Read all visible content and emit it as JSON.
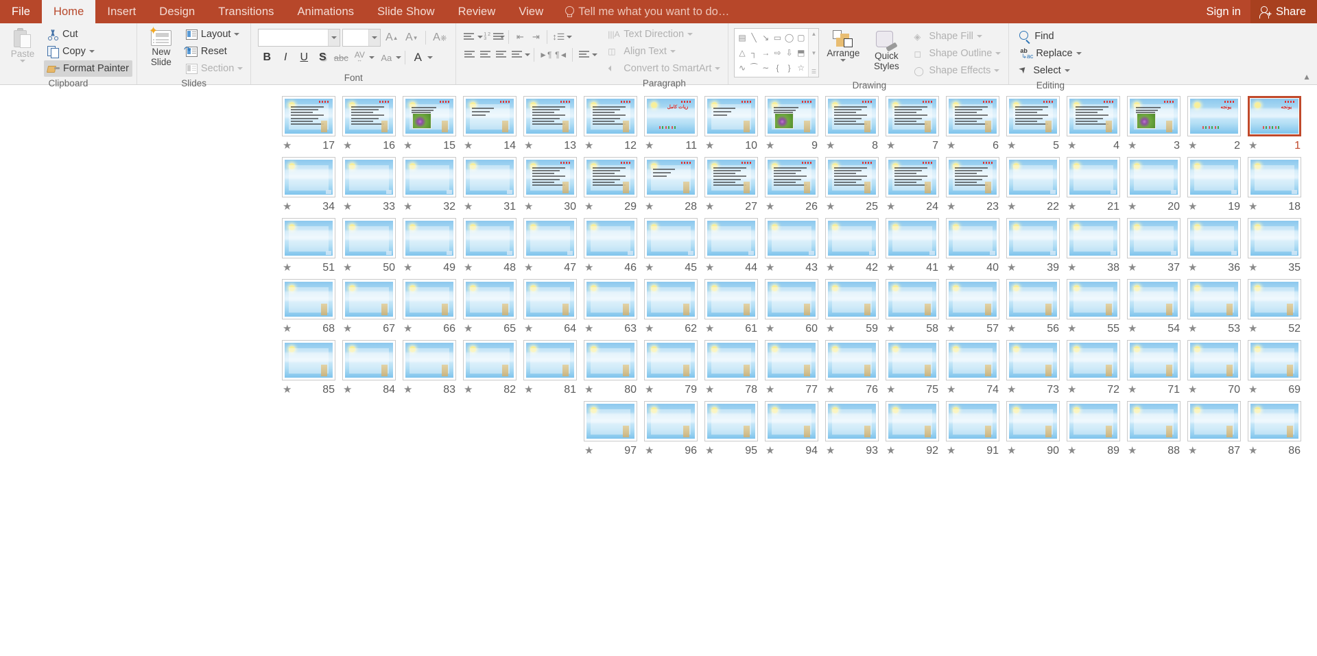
{
  "app": {
    "tabs": [
      {
        "label": "File",
        "type": "file"
      },
      {
        "label": "Home",
        "active": true
      },
      {
        "label": "Insert"
      },
      {
        "label": "Design"
      },
      {
        "label": "Transitions"
      },
      {
        "label": "Animations"
      },
      {
        "label": "Slide Show"
      },
      {
        "label": "Review"
      },
      {
        "label": "View"
      }
    ],
    "tell_me": "Tell me what you want to do…",
    "sign_in": "Sign in",
    "share": "Share",
    "accent_color": "#b7472a",
    "selection_color": "#c0492b"
  },
  "ribbon": {
    "groups": {
      "clipboard": {
        "label": "Clipboard",
        "paste": "Paste",
        "cut": "Cut",
        "copy": "Copy",
        "format_painter": "Format Painter"
      },
      "slides": {
        "label": "Slides",
        "new_slide_line1": "New",
        "new_slide_line2": "Slide",
        "layout": "Layout",
        "reset": "Reset",
        "section": "Section"
      },
      "font": {
        "label": "Font",
        "font_name_value": "",
        "font_size_value": "",
        "grow_font": "A",
        "shrink_font": "A",
        "clear_formatting": "A",
        "bold": "B",
        "italic": "I",
        "underline": "U",
        "shadow": "S",
        "strikethrough": "abc",
        "character_spacing": "AV",
        "change_case": "Aa",
        "font_color": "A"
      },
      "paragraph": {
        "label": "Paragraph",
        "text_direction": "Text Direction",
        "align_text": "Align Text",
        "convert_to_smartart": "Convert to SmartArt",
        "numbering_sample": "1 2 3"
      },
      "drawing": {
        "label": "Drawing",
        "arrange": "Arrange",
        "quick_styles_line1": "Quick",
        "quick_styles_line2": "Styles",
        "shape_fill": "Shape Fill",
        "shape_outline": "Shape Outline",
        "shape_effects": "Shape Effects",
        "shapes": [
          "textbox-shape",
          "line-shape",
          "arrow-shape",
          "rectangle-shape",
          "oval-shape",
          "rounded-rectangle-shape",
          "triangle-shape",
          "elbow-connector-shape",
          "elbow-arrow-shape",
          "right-arrow-shape",
          "down-arrow-shape",
          "folded-corner-shape",
          "scribble-shape",
          "arc-shape",
          "curve-shape",
          "left-brace-shape",
          "right-brace-shape",
          "star-shape"
        ],
        "shape_glyphs": [
          "▤",
          "╲",
          "↘",
          "▭",
          "◯",
          "▢",
          "△",
          "┐",
          "→",
          "⇨",
          "⇩",
          "⬒",
          "∿",
          "⁀",
          "∼",
          "{",
          "}",
          "☆"
        ]
      },
      "editing": {
        "label": "Editing",
        "find": "Find",
        "replace": "Replace",
        "select": "Select"
      }
    }
  },
  "slide_sorter": {
    "selected_slide": 1,
    "total_slides": 97,
    "rows": [
      {
        "from": 17,
        "to": 1
      },
      {
        "from": 34,
        "to": 18
      },
      {
        "from": 51,
        "to": 35
      },
      {
        "from": 68,
        "to": 52
      },
      {
        "from": 85,
        "to": 69
      },
      {
        "from": 97,
        "to": 86
      }
    ],
    "slides": [
      {
        "n": 1,
        "kind": "title",
        "title": "يونجه",
        "selected": true
      },
      {
        "n": 2,
        "kind": "title",
        "title": "يونجه"
      },
      {
        "n": 3,
        "kind": "photo"
      },
      {
        "n": 4,
        "kind": "text"
      },
      {
        "n": 5,
        "kind": "text"
      },
      {
        "n": 6,
        "kind": "text"
      },
      {
        "n": 7,
        "kind": "text"
      },
      {
        "n": 8,
        "kind": "text"
      },
      {
        "n": 9,
        "kind": "photo"
      },
      {
        "n": 10,
        "kind": "sparse"
      },
      {
        "n": 11,
        "kind": "title",
        "title": "زيات کامل"
      },
      {
        "n": 12,
        "kind": "text"
      },
      {
        "n": 13,
        "kind": "text"
      },
      {
        "n": 14,
        "kind": "sparse"
      },
      {
        "n": 15,
        "kind": "photo"
      },
      {
        "n": 16,
        "kind": "text"
      },
      {
        "n": 17,
        "kind": "text"
      },
      {
        "n": 18,
        "kind": "empty"
      },
      {
        "n": 19,
        "kind": "empty"
      },
      {
        "n": 20,
        "kind": "empty"
      },
      {
        "n": 21,
        "kind": "empty"
      },
      {
        "n": 22,
        "kind": "empty"
      },
      {
        "n": 23,
        "kind": "text"
      },
      {
        "n": 24,
        "kind": "text"
      },
      {
        "n": 25,
        "kind": "text"
      },
      {
        "n": 26,
        "kind": "text"
      },
      {
        "n": 27,
        "kind": "text"
      },
      {
        "n": 28,
        "kind": "sparse"
      },
      {
        "n": 29,
        "kind": "text"
      },
      {
        "n": 30,
        "kind": "text"
      },
      {
        "n": 31,
        "kind": "empty"
      },
      {
        "n": 32,
        "kind": "empty"
      },
      {
        "n": 33,
        "kind": "empty"
      },
      {
        "n": 34,
        "kind": "empty"
      },
      {
        "n": 35,
        "kind": "empty"
      },
      {
        "n": 36,
        "kind": "empty"
      },
      {
        "n": 37,
        "kind": "empty"
      },
      {
        "n": 38,
        "kind": "empty"
      },
      {
        "n": 39,
        "kind": "empty"
      },
      {
        "n": 40,
        "kind": "empty"
      },
      {
        "n": 41,
        "kind": "empty"
      },
      {
        "n": 42,
        "kind": "empty"
      },
      {
        "n": 43,
        "kind": "empty"
      },
      {
        "n": 44,
        "kind": "empty"
      },
      {
        "n": 45,
        "kind": "empty"
      },
      {
        "n": 46,
        "kind": "empty"
      },
      {
        "n": 47,
        "kind": "empty"
      },
      {
        "n": 48,
        "kind": "empty"
      },
      {
        "n": 49,
        "kind": "empty"
      },
      {
        "n": 50,
        "kind": "empty"
      },
      {
        "n": 51,
        "kind": "empty"
      },
      {
        "n": 52,
        "kind": "blank"
      },
      {
        "n": 53,
        "kind": "blank"
      },
      {
        "n": 54,
        "kind": "blank"
      },
      {
        "n": 55,
        "kind": "blank"
      },
      {
        "n": 56,
        "kind": "blank"
      },
      {
        "n": 57,
        "kind": "blank"
      },
      {
        "n": 58,
        "kind": "blank"
      },
      {
        "n": 59,
        "kind": "blank"
      },
      {
        "n": 60,
        "kind": "blank"
      },
      {
        "n": 61,
        "kind": "blank"
      },
      {
        "n": 62,
        "kind": "blank"
      },
      {
        "n": 63,
        "kind": "blank"
      },
      {
        "n": 64,
        "kind": "blank"
      },
      {
        "n": 65,
        "kind": "blank"
      },
      {
        "n": 66,
        "kind": "blank"
      },
      {
        "n": 67,
        "kind": "blank"
      },
      {
        "n": 68,
        "kind": "blank"
      },
      {
        "n": 69,
        "kind": "blank"
      },
      {
        "n": 70,
        "kind": "blank"
      },
      {
        "n": 71,
        "kind": "blank"
      },
      {
        "n": 72,
        "kind": "blank"
      },
      {
        "n": 73,
        "kind": "blank"
      },
      {
        "n": 74,
        "kind": "blank"
      },
      {
        "n": 75,
        "kind": "blank"
      },
      {
        "n": 76,
        "kind": "blank"
      },
      {
        "n": 77,
        "kind": "blank"
      },
      {
        "n": 78,
        "kind": "blank"
      },
      {
        "n": 79,
        "kind": "blank"
      },
      {
        "n": 80,
        "kind": "blank"
      },
      {
        "n": 81,
        "kind": "blank"
      },
      {
        "n": 82,
        "kind": "blank"
      },
      {
        "n": 83,
        "kind": "blank"
      },
      {
        "n": 84,
        "kind": "blank"
      },
      {
        "n": 85,
        "kind": "blank"
      },
      {
        "n": 86,
        "kind": "blank"
      },
      {
        "n": 87,
        "kind": "blank"
      },
      {
        "n": 88,
        "kind": "blank"
      },
      {
        "n": 89,
        "kind": "blank"
      },
      {
        "n": 90,
        "kind": "blank"
      },
      {
        "n": 91,
        "kind": "blank"
      },
      {
        "n": 92,
        "kind": "blank"
      },
      {
        "n": 93,
        "kind": "blank"
      },
      {
        "n": 94,
        "kind": "blank"
      },
      {
        "n": 95,
        "kind": "blank"
      },
      {
        "n": 96,
        "kind": "blank"
      },
      {
        "n": 97,
        "kind": "blank"
      }
    ],
    "star_glyph": "★"
  }
}
